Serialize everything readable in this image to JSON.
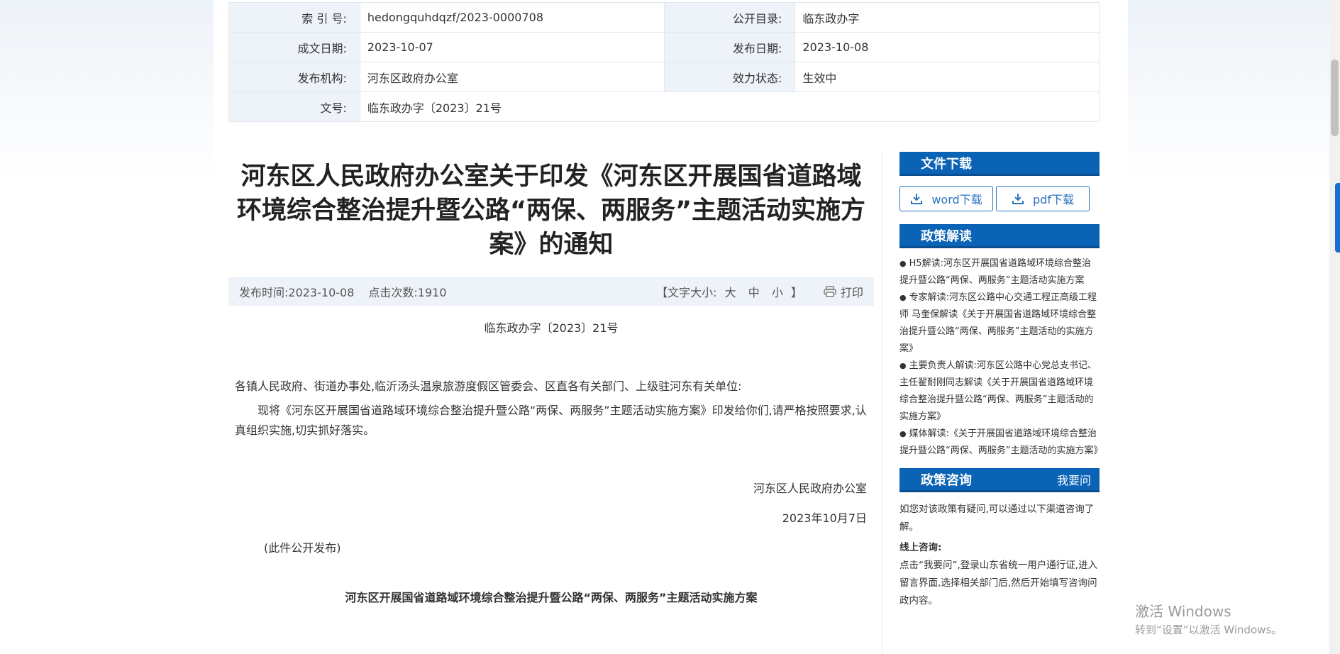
{
  "meta": {
    "rows": [
      {
        "k1": "索 引 号:",
        "v1": "hedongquhdqzf/2023-0000708",
        "k2": "公开目录:",
        "v2": "临东政办字"
      },
      {
        "k1": "成文日期:",
        "v1": "2023-10-07",
        "k2": "发布日期:",
        "v2": "2023-10-08"
      },
      {
        "k1": "发布机构:",
        "v1": "河东区政府办公室",
        "k2": "效力状态:",
        "v2": "生效中"
      }
    ],
    "docno_label": "文号:",
    "docno_value": "临东政办字〔2023〕21号"
  },
  "article": {
    "title": "河东区人民政府办公室关于印发《河东区开展国省道路域环境综合整治提升暨公路“两保、两服务”主题活动实施方案》的通知",
    "publish_time": "发布时间:2023-10-08",
    "clicks": "点击次数:1910",
    "font_size_label": "【文字大小:",
    "font_large": "大",
    "font_medium": "中",
    "font_small": "小",
    "font_close": "】",
    "print": "打印",
    "doc_number": "临东政办字〔2023〕21号",
    "addressees": "各镇人民政府、街道办事处,临沂汤头温泉旅游度假区管委会、区直各有关部门、上级驻河东有关单位:",
    "paragraph": "现将《河东区开展国省道路域环境综合整治提升暨公路“两保、两服务”主题活动实施方案》印发给你们,请严格按照要求,认真组织实施,切实抓好落实。",
    "signature": "河东区人民政府办公室",
    "date": "2023年10月7日",
    "public_note": "(此件公开发布)",
    "subtitle": "河东区开展国省道路域环境综合整治提升暨公路“两保、两服务”主题活动实施方案"
  },
  "sidebar": {
    "download_title": "文件下载",
    "word_btn": "word下载",
    "pdf_btn": "pdf下载",
    "interp_title": "政策解读",
    "interp_items": [
      "H5解读:河东区开展国省道路域环境综合整治提升暨公路“两保、两服务”主题活动实施方案",
      "专家解读:河东区公路中心交通工程正高级工程师 马奎保解读《关于开展国省道路域环境综合整治提升暨公路“两保、两服务”主题活动的实施方案》",
      "主要负责人解读:河东区公路中心党总支书记、主任翟耐刚同志解读《关于开展国省道路域环境综合整治提升暨公路“两保、两服务”主题活动的实施方案》",
      "媒体解读:《关于开展国省道路域环境综合整治提升暨公路“两保、两服务”主题活动的实施方案》"
    ],
    "consult_title": "政策咨询",
    "consult_more": "我要问",
    "consult_intro": "如您对该政策有疑问,可以通过以下渠道咨询了解。",
    "online_label": "线上咨询:",
    "online_text": "点击“我要问”,登录山东省统一用户通行证,进入留言界面,选择相关部门后,然后开始填写咨询问政内容。"
  },
  "watermark": {
    "line1": "激活 Windows",
    "line2": "转到“设置”以激活 Windows。"
  },
  "colors": {
    "accent": "#0a63b5",
    "meta_key_bg": "#eef3fa"
  }
}
